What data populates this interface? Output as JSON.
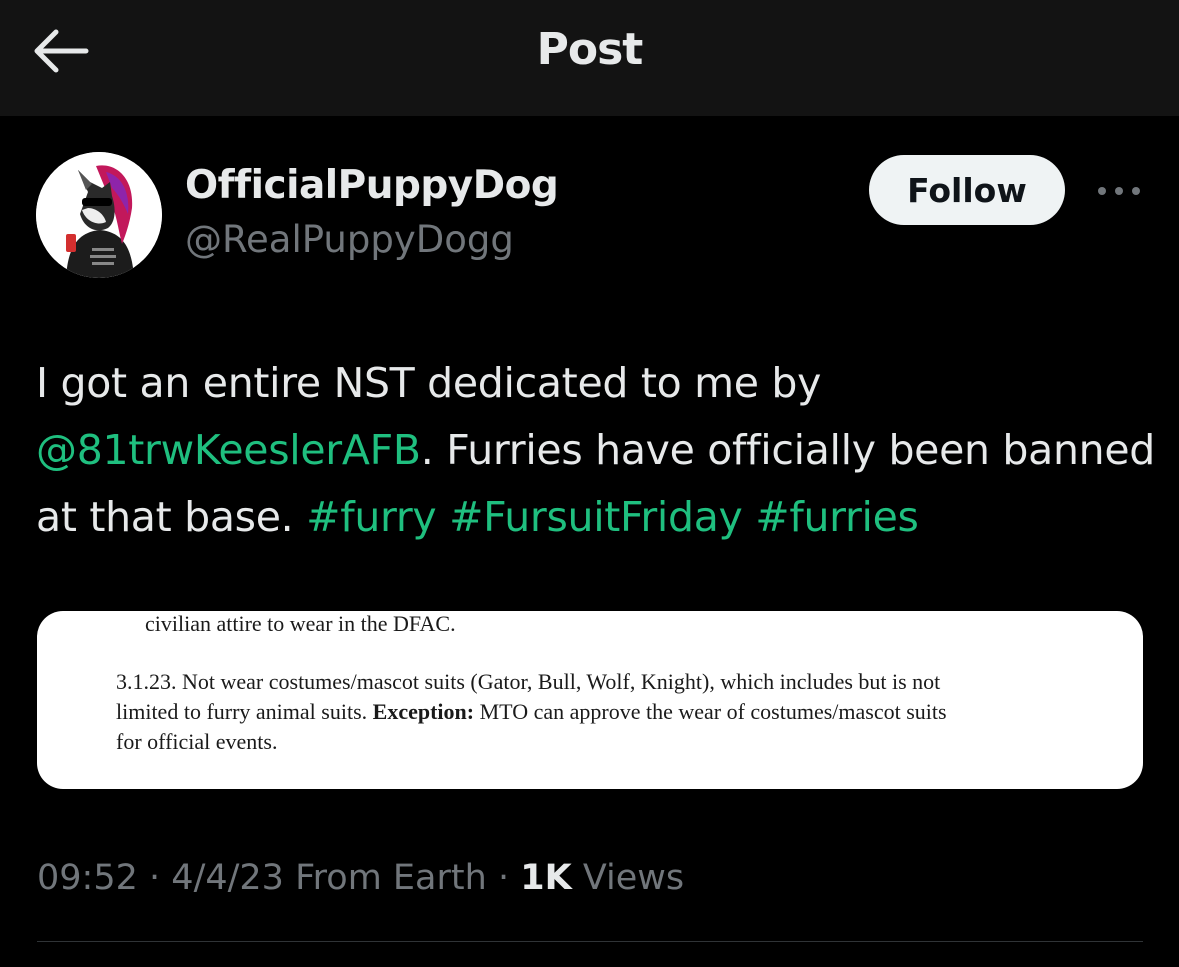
{
  "header": {
    "title": "Post",
    "back_icon": "arrow-left-icon"
  },
  "author": {
    "display_name": "OfficialPuppyDog",
    "handle": "@RealPuppyDogg",
    "avatar_icon": "avatar-image",
    "follow_label": "Follow",
    "more_icon": "more-options-icon"
  },
  "post": {
    "text_1": "I got an entire NST dedicated to me by ",
    "mention": "@81trwKeeslerAFB",
    "text_2": ". Furries have officially been banned at that base. ",
    "hashtags": [
      "#furry",
      "#FursuitFriday",
      "#furries"
    ],
    "link_color": "#1fbf7f"
  },
  "media": {
    "line_1": "civilian attire to wear in the DFAC.",
    "line_2": "3.1.23. Not wear costumes/mascot suits (Gator, Bull, Wolf, Knight), which includes but is not",
    "line_3_a": "limited to furry animal suits. ",
    "line_3_bold": "Exception:",
    "line_3_b": " MTO can approve the wear of costumes/mascot suits",
    "line_4": "for official events."
  },
  "meta": {
    "time": "09:52",
    "date": "4/4/23",
    "source": "From Earth",
    "views_count": "1K",
    "views_label": "Views",
    "separator": "·"
  }
}
